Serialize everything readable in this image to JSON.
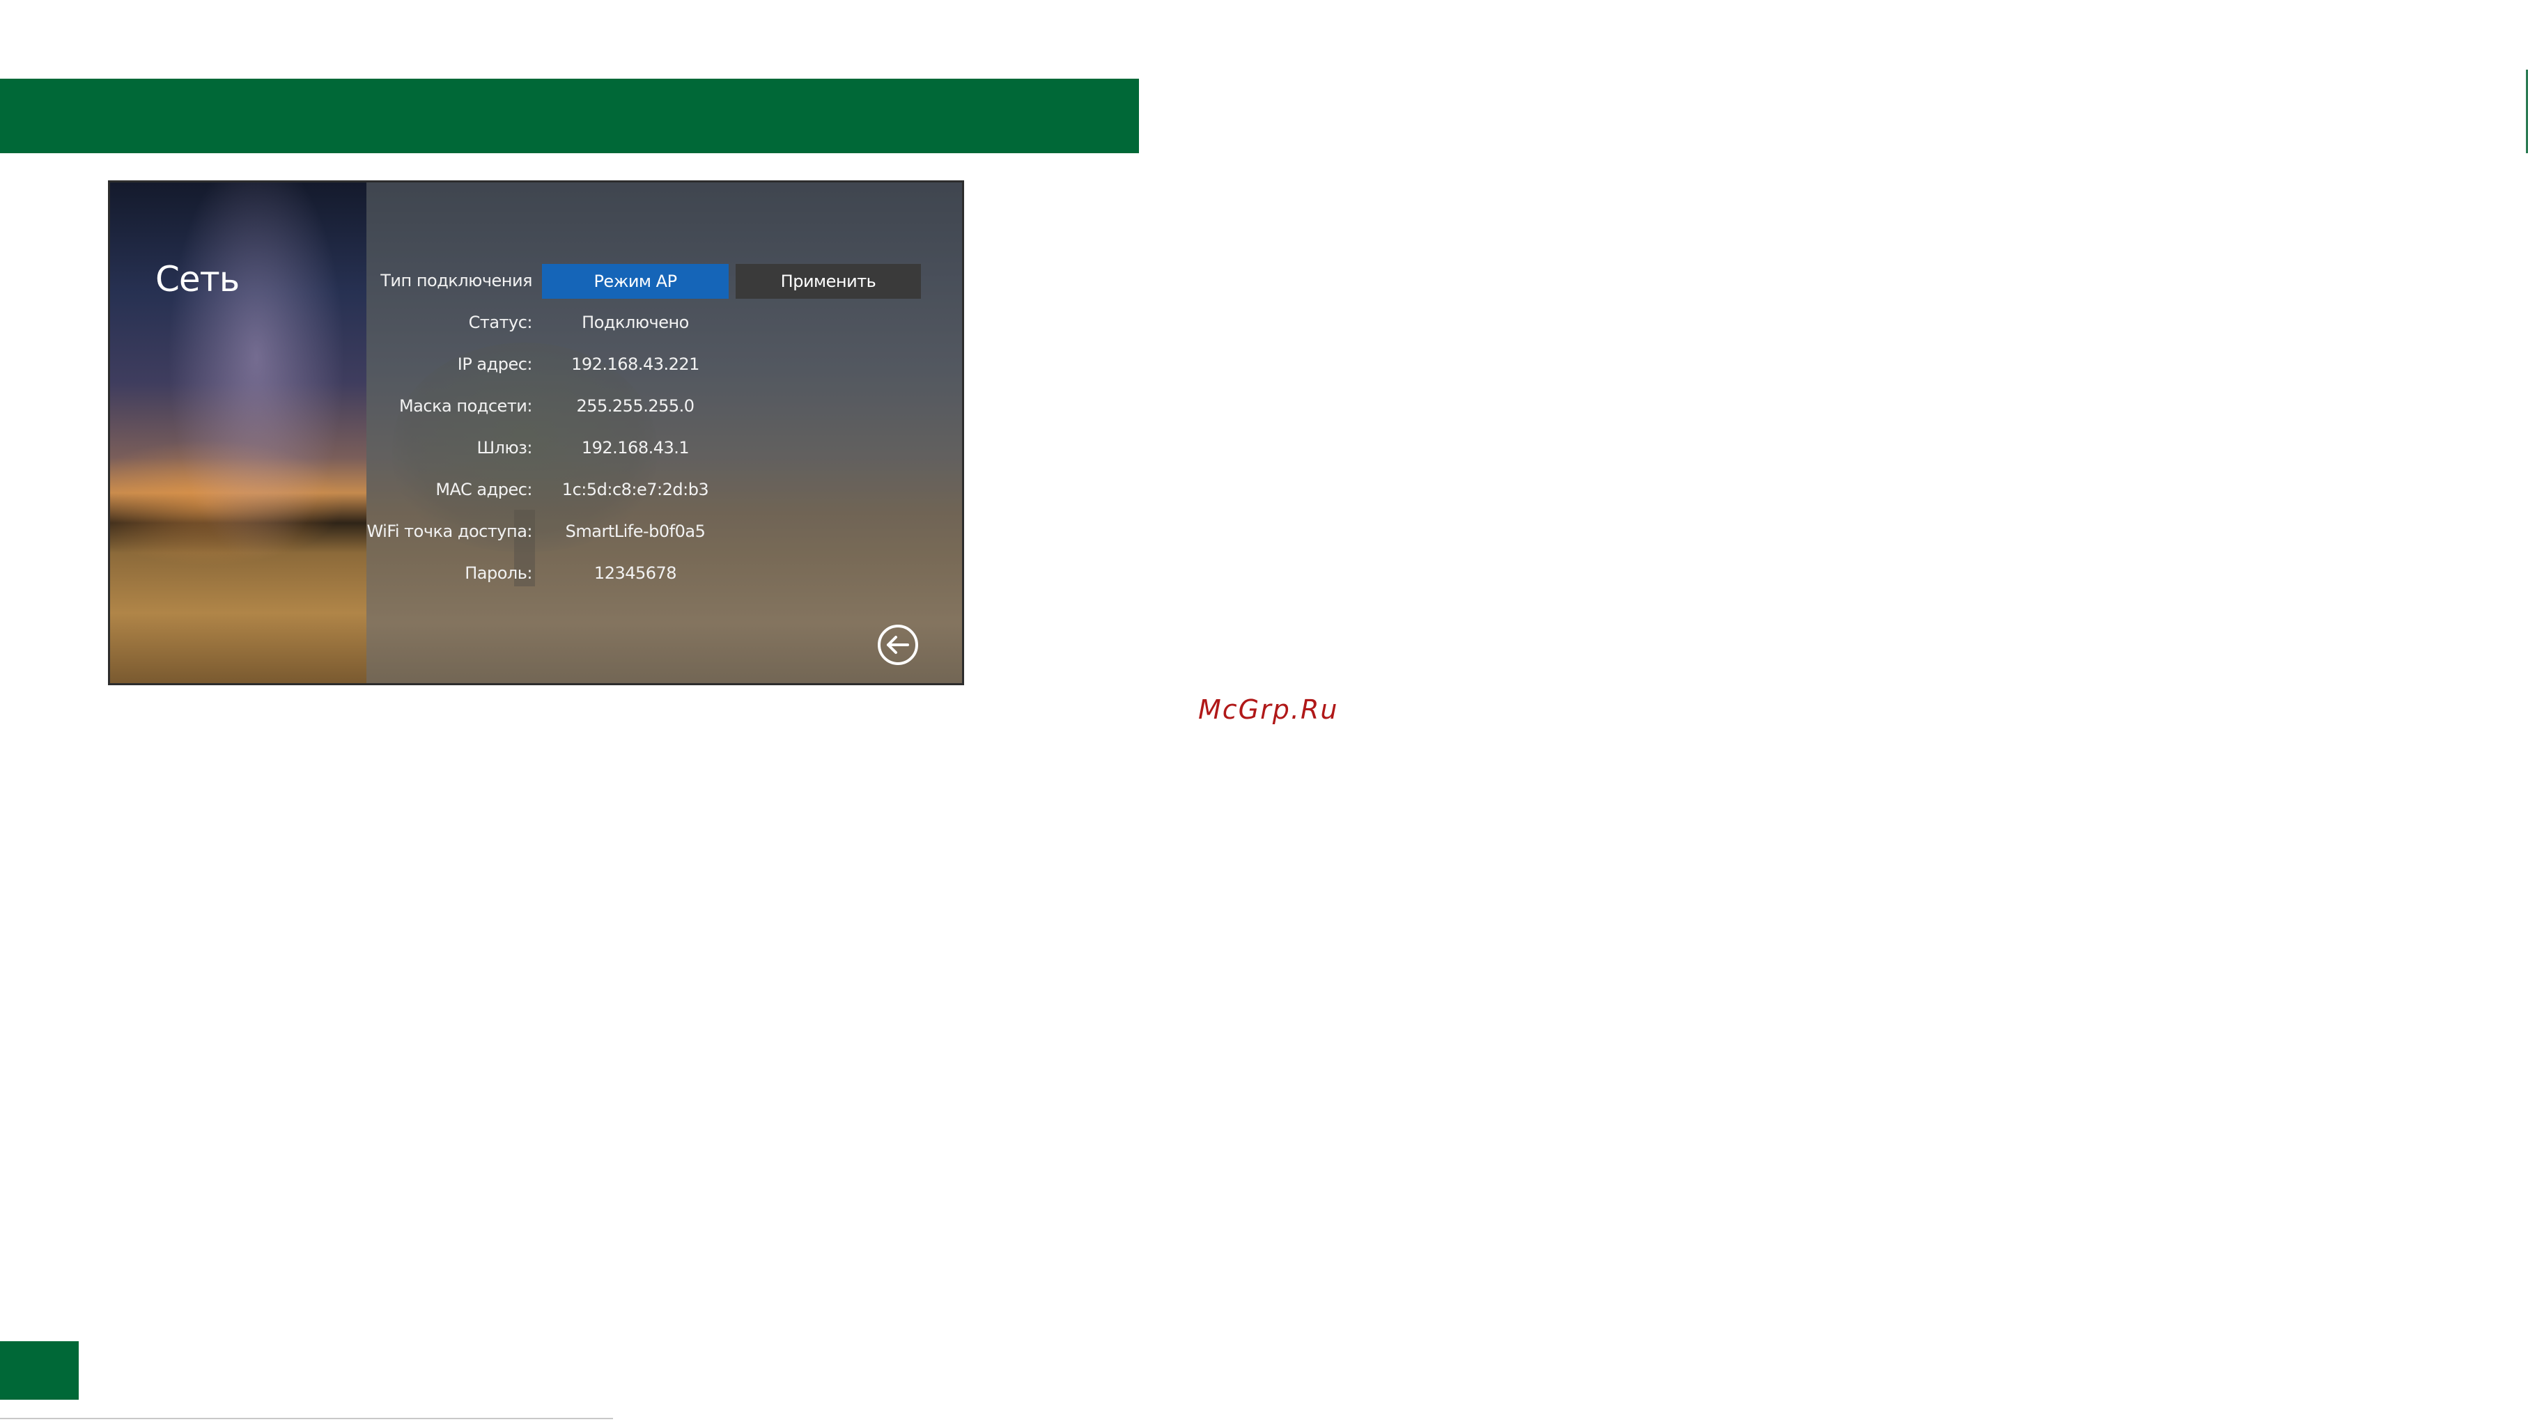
{
  "screen": {
    "title": "Сеть",
    "rows": [
      {
        "label": "Тип подключения",
        "value": null
      },
      {
        "label": "Статус:",
        "value": "Подключено"
      },
      {
        "label": "IP адрес:",
        "value": "192.168.43.221"
      },
      {
        "label": "Маска подсети:",
        "value": "255.255.255.0"
      },
      {
        "label": "Шлюз:",
        "value": "192.168.43.1"
      },
      {
        "label": "MAC адрес:",
        "value": "1c:5d:c8:e7:2d:b3"
      },
      {
        "label": "WiFi точка доступа:",
        "value": "SmartLife-b0f0a5"
      },
      {
        "label": "Пароль:",
        "value": "12345678"
      }
    ],
    "mode_button": "Режим AP",
    "apply_button": "Применить",
    "back_icon": "arrow-left-circle-icon"
  },
  "watermark": "McGrp.Ru",
  "colors": {
    "header_green": "#006837",
    "mode_blue": "#1565b8",
    "apply_dark": "#3a3a3a",
    "watermark_red": "#b01818"
  }
}
